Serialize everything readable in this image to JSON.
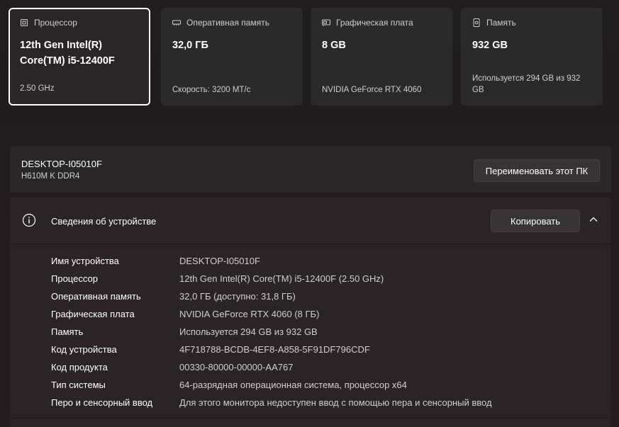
{
  "cards": [
    {
      "title": "Процессор",
      "icon": "cpu-icon",
      "main": "12th Gen Intel(R)\nCore(TM) i5-12400F",
      "sub": "2.50 GHz"
    },
    {
      "title": "Оперативная память",
      "icon": "ram-icon",
      "main": "32,0 ГБ",
      "sub": "Скорость: 3200 МТ/с"
    },
    {
      "title": "Графическая плата",
      "icon": "gpu-icon",
      "main": "8 GB",
      "sub": "NVIDIA GeForce RTX 4060"
    },
    {
      "title": "Память",
      "icon": "storage-icon",
      "main": "932 GB",
      "sub": "Используется 294 GB из 932 GB"
    }
  ],
  "pc": {
    "name": "DESKTOP-I05010F",
    "model": "H610M K DDR4",
    "rename_label": "Переименовать этот ПК"
  },
  "device_info": {
    "title": "Сведения об устройстве",
    "copy_label": "Копировать",
    "rows": [
      {
        "label": "Имя устройства",
        "value": "DESKTOP-I05010F"
      },
      {
        "label": "Процессор",
        "value": "12th Gen Intel(R) Core(TM) i5-12400F (2.50 GHz)"
      },
      {
        "label": "Оперативная память",
        "value": "32,0 ГБ (доступно: 31,8 ГБ)"
      },
      {
        "label": "Графическая плата",
        "value": "NVIDIA GeForce RTX 4060 (8 ГБ)"
      },
      {
        "label": "Память",
        "value": "Используется 294 GB из 932 GB"
      },
      {
        "label": "Код устройства",
        "value": "4F718788-BCDB-4EF8-A858-5F91DF796CDF"
      },
      {
        "label": "Код продукта",
        "value": "00330-80000-00000-AA767"
      },
      {
        "label": "Тип системы",
        "value": "64-разрядная операционная система, процессор x64"
      },
      {
        "label": "Перо и сенсорный ввод",
        "value": "Для этого монитора недоступен ввод с помощью пера и сенсорный ввод"
      }
    ]
  }
}
